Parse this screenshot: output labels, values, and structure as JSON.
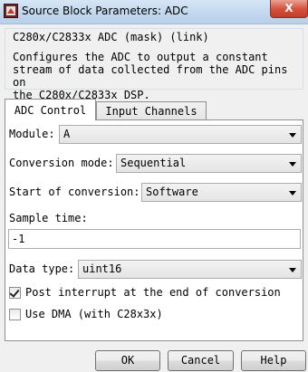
{
  "window": {
    "title": "Source Block Parameters: ADC",
    "close_label": "X"
  },
  "description": {
    "legend": "C280x/C2833x ADC (mask) (link)",
    "text": "Configures the ADC to output a constant\nstream of data collected from the ADC pins on\nthe C280x/C2833x DSP."
  },
  "tabs": [
    {
      "label": "ADC Control",
      "active": true
    },
    {
      "label": "Input Channels",
      "active": false
    }
  ],
  "form": {
    "module": {
      "label": "Module:",
      "value": "A"
    },
    "conversion_mode": {
      "label": "Conversion mode:",
      "value": "Sequential"
    },
    "start_of_conversion": {
      "label": "Start of conversion:",
      "value": "Software"
    },
    "sample_time": {
      "label": "Sample time:",
      "value": "-1"
    },
    "data_type": {
      "label": "Data type:",
      "value": "uint16"
    },
    "post_interrupt": {
      "label": "Post interrupt at the end of conversion",
      "checked": true
    },
    "use_dma": {
      "label": "Use DMA (with C28x3x)",
      "checked": false
    }
  },
  "buttons": {
    "ok": "OK",
    "cancel": "Cancel",
    "help": "Help"
  },
  "icons": {
    "app": "simulink-block-icon",
    "dropdown": "chevron-down-icon",
    "check": "checkmark-icon"
  },
  "colors": {
    "titlebar": "#c4d9ee",
    "close": "#d6543f",
    "panel": "#ffffff",
    "dialog": "#f0f0f0"
  }
}
